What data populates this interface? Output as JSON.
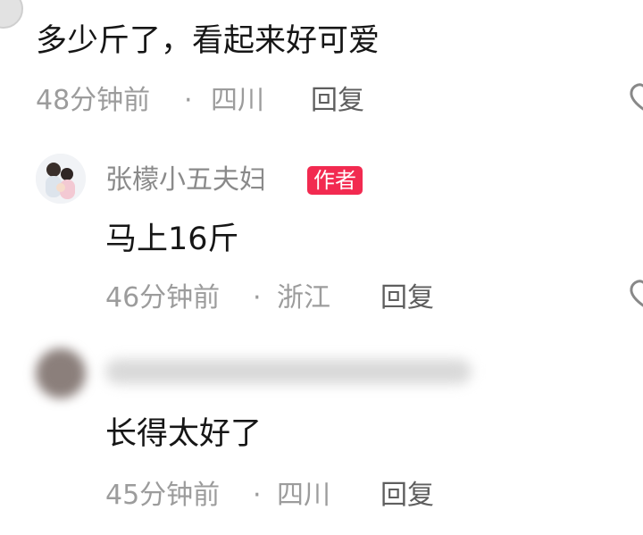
{
  "comments": [
    {
      "text": "多少斤了，看起来好可爱",
      "time": "48分钟前",
      "separator": "·",
      "location": "四川",
      "reply_label": "回复"
    },
    {
      "username": "张檬小五夫妇",
      "badge": "作者",
      "text": "马上16斤",
      "time": "46分钟前",
      "separator": "·",
      "location": "浙江",
      "reply_label": "回复"
    },
    {
      "text": "长得太好了",
      "time": "45分钟前",
      "separator": "·",
      "location": "四川",
      "reply_label": "回复"
    }
  ],
  "colors": {
    "badge": "#f22a50",
    "text": "#161616",
    "meta": "#9c9c9c"
  },
  "icons": [
    "avatar",
    "heart-icon"
  ]
}
